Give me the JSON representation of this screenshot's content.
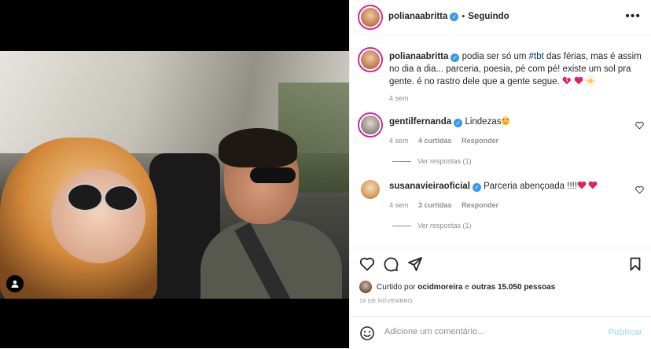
{
  "header": {
    "username": "polianaabritta",
    "dot": "•",
    "follow_status": "Seguindo",
    "more": "•••"
  },
  "caption": {
    "username": "polianaabritta",
    "text_before": "podia ser só um ",
    "hashtag": "#tbt",
    "text_after": " das férias, mas é assim no dia a dia... parceria, poesia, pé com pé! existe um sol pra gente. é no rastro dele que a gente segue.",
    "emojis": [
      "heart-broken-emoji",
      "red-heart-emoji",
      "sun-emoji"
    ],
    "time": "4 sem"
  },
  "comments": [
    {
      "username": "gentilfernanda",
      "text": "Lindezas",
      "emoji": "heart-eyes-emoji",
      "time": "4 sem",
      "likes": "4 curtidas",
      "reply": "Responder",
      "view_replies": "Ver respostas (1)"
    },
    {
      "username": "susanavieiraoficial",
      "text": "Parceria abençoada !!!!",
      "emoji": "two-red-hearts-emoji",
      "time": "4 sem",
      "likes": "3 curtidas",
      "reply": "Responder",
      "view_replies": "Ver respostas (1)"
    }
  ],
  "likes": {
    "prefix": "Curtido por",
    "user": "ocidmoreira",
    "middle": "e",
    "others": "outras 15.050 pessoas"
  },
  "date": "18 DE NOVEMBRO",
  "comment_box": {
    "placeholder": "Adicione um comentário...",
    "publish": "Publicar"
  },
  "colors": {
    "verified": "#3897f0",
    "link": "#00376b",
    "publish_disabled": "#b2dffc",
    "heart": "#ed4956"
  }
}
